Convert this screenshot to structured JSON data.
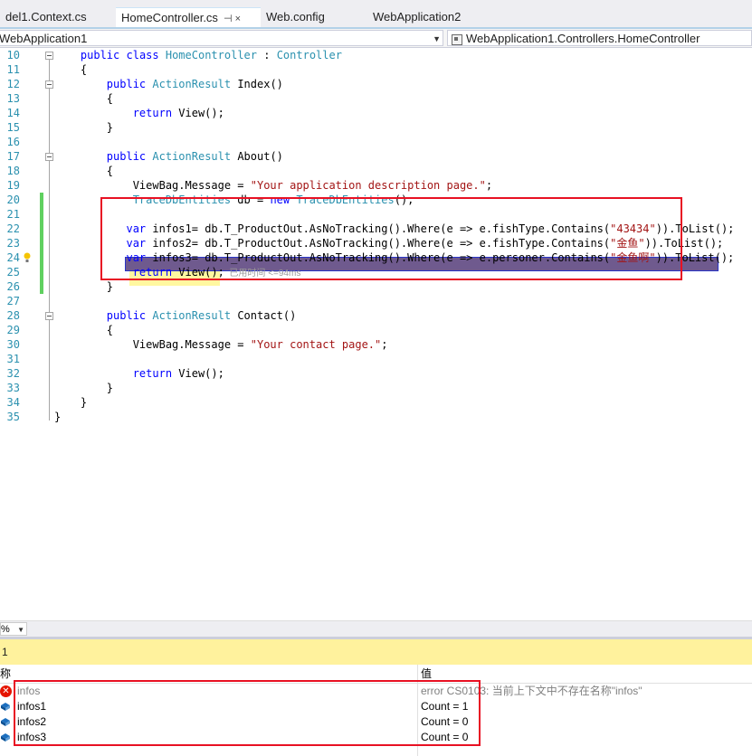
{
  "tabs": [
    {
      "label": "del1.Context.cs"
    },
    {
      "label": "HomeController.cs",
      "pin": "⊣ ×"
    },
    {
      "label": "Web.config"
    },
    {
      "label": "WebApplication2"
    }
  ],
  "nav": {
    "project": "WebApplication1",
    "type": "WebApplication1.Controllers.HomeController"
  },
  "code_lines": [
    {
      "num": "10",
      "parts": [
        {
          "t": "    ",
          "c": ""
        },
        {
          "t": "public",
          "c": "kw"
        },
        {
          "t": " ",
          "c": ""
        },
        {
          "t": "class",
          "c": "kw"
        },
        {
          "t": " ",
          "c": ""
        },
        {
          "t": "HomeController",
          "c": "ty"
        },
        {
          "t": " : ",
          "c": ""
        },
        {
          "t": "Controller",
          "c": "ty"
        }
      ]
    },
    {
      "num": "11",
      "parts": [
        {
          "t": "    {",
          "c": ""
        }
      ]
    },
    {
      "num": "12",
      "parts": [
        {
          "t": "        ",
          "c": ""
        },
        {
          "t": "public",
          "c": "kw"
        },
        {
          "t": " ",
          "c": ""
        },
        {
          "t": "ActionResult",
          "c": "ty"
        },
        {
          "t": " Index()",
          "c": ""
        }
      ]
    },
    {
      "num": "13",
      "parts": [
        {
          "t": "        {",
          "c": ""
        }
      ]
    },
    {
      "num": "14",
      "parts": [
        {
          "t": "            ",
          "c": ""
        },
        {
          "t": "return",
          "c": "kw"
        },
        {
          "t": " View();",
          "c": ""
        }
      ]
    },
    {
      "num": "15",
      "parts": [
        {
          "t": "        }",
          "c": ""
        }
      ]
    },
    {
      "num": "16",
      "parts": []
    },
    {
      "num": "17",
      "parts": [
        {
          "t": "        ",
          "c": ""
        },
        {
          "t": "public",
          "c": "kw"
        },
        {
          "t": " ",
          "c": ""
        },
        {
          "t": "ActionResult",
          "c": "ty"
        },
        {
          "t": " About()",
          "c": ""
        }
      ]
    },
    {
      "num": "18",
      "parts": [
        {
          "t": "        {",
          "c": ""
        }
      ]
    },
    {
      "num": "19",
      "parts": [
        {
          "t": "            ViewBag.Message = ",
          "c": ""
        },
        {
          "t": "\"Your application description page.\"",
          "c": "str"
        },
        {
          "t": ";",
          "c": ""
        }
      ]
    },
    {
      "num": "20",
      "parts": [
        {
          "t": "            ",
          "c": ""
        },
        {
          "t": "TraceDbEntities",
          "c": "ty"
        },
        {
          "t": " db = ",
          "c": ""
        },
        {
          "t": "new",
          "c": "kw"
        },
        {
          "t": " ",
          "c": ""
        },
        {
          "t": "TraceDbEntities",
          "c": "ty"
        },
        {
          "t": "();",
          "c": ""
        }
      ]
    },
    {
      "num": "21",
      "parts": []
    },
    {
      "num": "22",
      "parts": [
        {
          "t": "           ",
          "c": ""
        },
        {
          "t": "var",
          "c": "kw"
        },
        {
          "t": " infos1= db.T_ProductOut.AsNoTracking().Where(e => e.fishType.Contains(",
          "c": ""
        },
        {
          "t": "\"43434\"",
          "c": "str"
        },
        {
          "t": ")).ToList();",
          "c": ""
        }
      ]
    },
    {
      "num": "23",
      "parts": [
        {
          "t": "           ",
          "c": ""
        },
        {
          "t": "var",
          "c": "kw"
        },
        {
          "t": " infos2= db.T_ProductOut.AsNoTracking().Where(e => e.fishType.Contains(",
          "c": ""
        },
        {
          "t": "\"金鱼\"",
          "c": "str"
        },
        {
          "t": ")).ToList();",
          "c": ""
        }
      ]
    },
    {
      "num": "24",
      "parts": [
        {
          "t": "           ",
          "c": ""
        },
        {
          "t": "var",
          "c": "kw"
        },
        {
          "t": " infos3= db.T_ProductOut.AsNoTracking().Where(e => e.personer.Contains(",
          "c": ""
        },
        {
          "t": "\"金鱼啊\"",
          "c": "str"
        },
        {
          "t": ")).ToList();",
          "c": ""
        }
      ]
    },
    {
      "num": "25",
      "parts": [
        {
          "t": "            ",
          "c": ""
        },
        {
          "t": "return",
          "c": "kw"
        },
        {
          "t": " View();",
          "c": ""
        }
      ],
      "perf": "已用时间 <=94ms"
    },
    {
      "num": "26",
      "parts": [
        {
          "t": "        }",
          "c": ""
        }
      ]
    },
    {
      "num": "27",
      "parts": []
    },
    {
      "num": "28",
      "parts": [
        {
          "t": "        ",
          "c": ""
        },
        {
          "t": "public",
          "c": "kw"
        },
        {
          "t": " ",
          "c": ""
        },
        {
          "t": "ActionResult",
          "c": "ty"
        },
        {
          "t": " Contact()",
          "c": ""
        }
      ]
    },
    {
      "num": "29",
      "parts": [
        {
          "t": "        {",
          "c": ""
        }
      ]
    },
    {
      "num": "30",
      "parts": [
        {
          "t": "            ViewBag.Message = ",
          "c": ""
        },
        {
          "t": "\"Your contact page.\"",
          "c": "str"
        },
        {
          "t": ";",
          "c": ""
        }
      ]
    },
    {
      "num": "31",
      "parts": []
    },
    {
      "num": "32",
      "parts": [
        {
          "t": "            ",
          "c": ""
        },
        {
          "t": "return",
          "c": "kw"
        },
        {
          "t": " View();",
          "c": ""
        }
      ]
    },
    {
      "num": "33",
      "parts": [
        {
          "t": "        }",
          "c": ""
        }
      ]
    },
    {
      "num": "34",
      "parts": [
        {
          "t": "    }",
          "c": ""
        }
      ]
    },
    {
      "num": "35",
      "parts": [
        {
          "t": "}",
          "c": ""
        }
      ]
    }
  ],
  "zoom": "%",
  "watch": {
    "tab_label": "1",
    "col_name": "称",
    "col_value": "值",
    "rows": [
      {
        "name": "infos",
        "value": "error CS0103: 当前上下文中不存在名称\"infos\"",
        "icon": "error-icon"
      },
      {
        "name": "infos1",
        "value": "Count = 1",
        "icon": "variable-icon"
      },
      {
        "name": "infos2",
        "value": "Count = 0",
        "icon": "variable-icon"
      },
      {
        "name": "infos3",
        "value": "Count = 0",
        "icon": "variable-icon"
      }
    ]
  },
  "colors": {
    "keyword": "#0000ff",
    "type": "#2b91af",
    "string": "#a31515",
    "highlight": "#e81123"
  }
}
